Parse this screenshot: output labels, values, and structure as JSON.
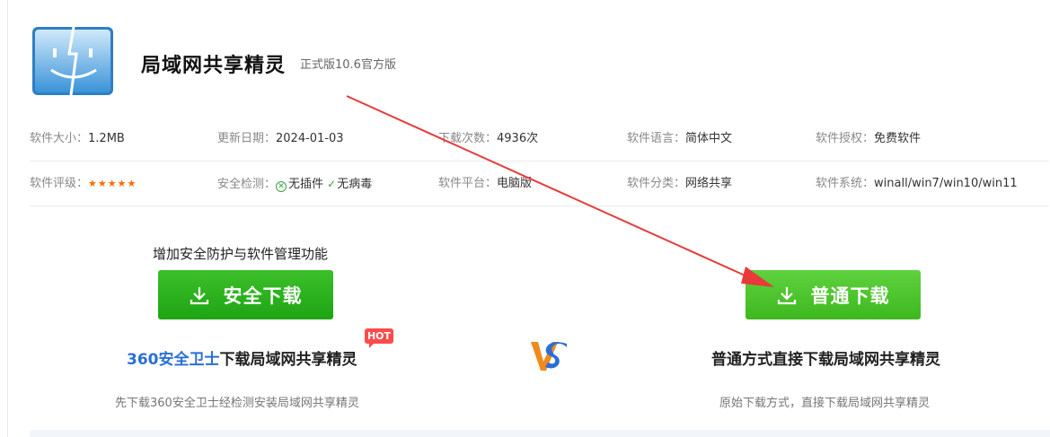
{
  "app": {
    "title": "局域网共享精灵",
    "version": "正式版10.6官方版"
  },
  "info_row1": [
    {
      "label": "软件大小：",
      "value": "1.2MB"
    },
    {
      "label": "更新日期：",
      "value": "2024-01-03"
    },
    {
      "label": "下载次数：",
      "value": "4936次"
    },
    {
      "label": "软件语言：",
      "value": "简体中文"
    },
    {
      "label": "软件授权：",
      "value": "免费软件"
    }
  ],
  "info_row2": {
    "rating": {
      "label": "软件评级：",
      "stars": "★★★★★",
      "value": 5
    },
    "security": {
      "label": "安全检测：",
      "no_plugin": "无插件",
      "no_virus": "无病毒"
    },
    "platform": {
      "label": "软件平台：",
      "value": "电脑版"
    },
    "category": {
      "label": "软件分类：",
      "value": "网络共享"
    },
    "system": {
      "label": "软件系统：",
      "value": "winall/win7/win10/win11"
    }
  },
  "download": {
    "promo_tip": "增加安全防护与软件管理功能",
    "safe_button": "安全下载",
    "normal_button": "普通下载",
    "hot_badge": "HOT",
    "left_brand": "360安全卫士",
    "left_title_rest": "下载局域网共享精灵",
    "right_title": "普通方式直接下载局域网共享精灵",
    "left_sub": "先下载360安全卫士经检测安装局域网共享精灵",
    "right_sub": "原始下载方式，直接下载局域网共享精灵"
  },
  "colors": {
    "button_green": "#4cc52a",
    "brand_blue": "#2a6fd6",
    "hot_red": "#ff4b4b",
    "arrow_red": "#e83a3a",
    "star_orange": "#ff6a00"
  }
}
